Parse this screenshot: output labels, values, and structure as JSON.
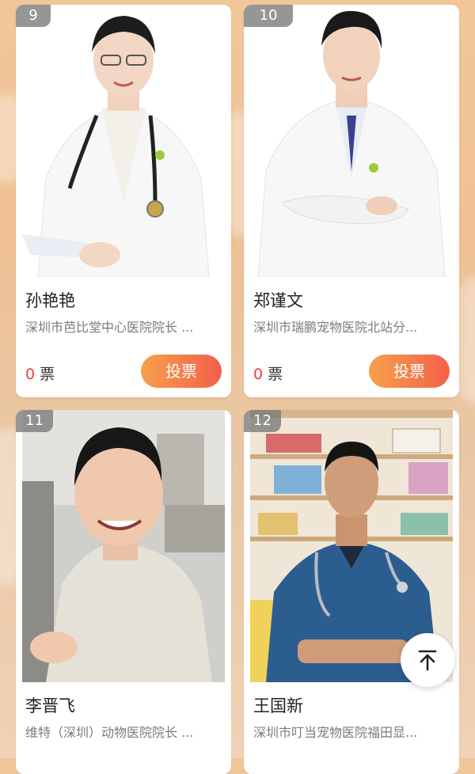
{
  "cards": [
    {
      "rank": "9",
      "name": "孙艳艳",
      "org": "深圳市芭比堂中心医院院长 ...",
      "votes": "0",
      "vote_unit": "票",
      "vote_label": "投票"
    },
    {
      "rank": "10",
      "name": "郑谨文",
      "org": "深圳市瑞鹏宠物医院北站分...",
      "votes": "0",
      "vote_unit": "票",
      "vote_label": "投票"
    },
    {
      "rank": "11",
      "name": "李晋飞",
      "org": "维特（深圳）动物医院院长 ..."
    },
    {
      "rank": "12",
      "name": "王国新",
      "org": "深圳市叮当宠物医院福田显..."
    }
  ],
  "colors": {
    "accent_start": "#f7a04b",
    "accent_end": "#f2604a",
    "vote_number": "#ef3e3e"
  },
  "icons": {
    "back_to_top": "arrow-up-icon"
  }
}
